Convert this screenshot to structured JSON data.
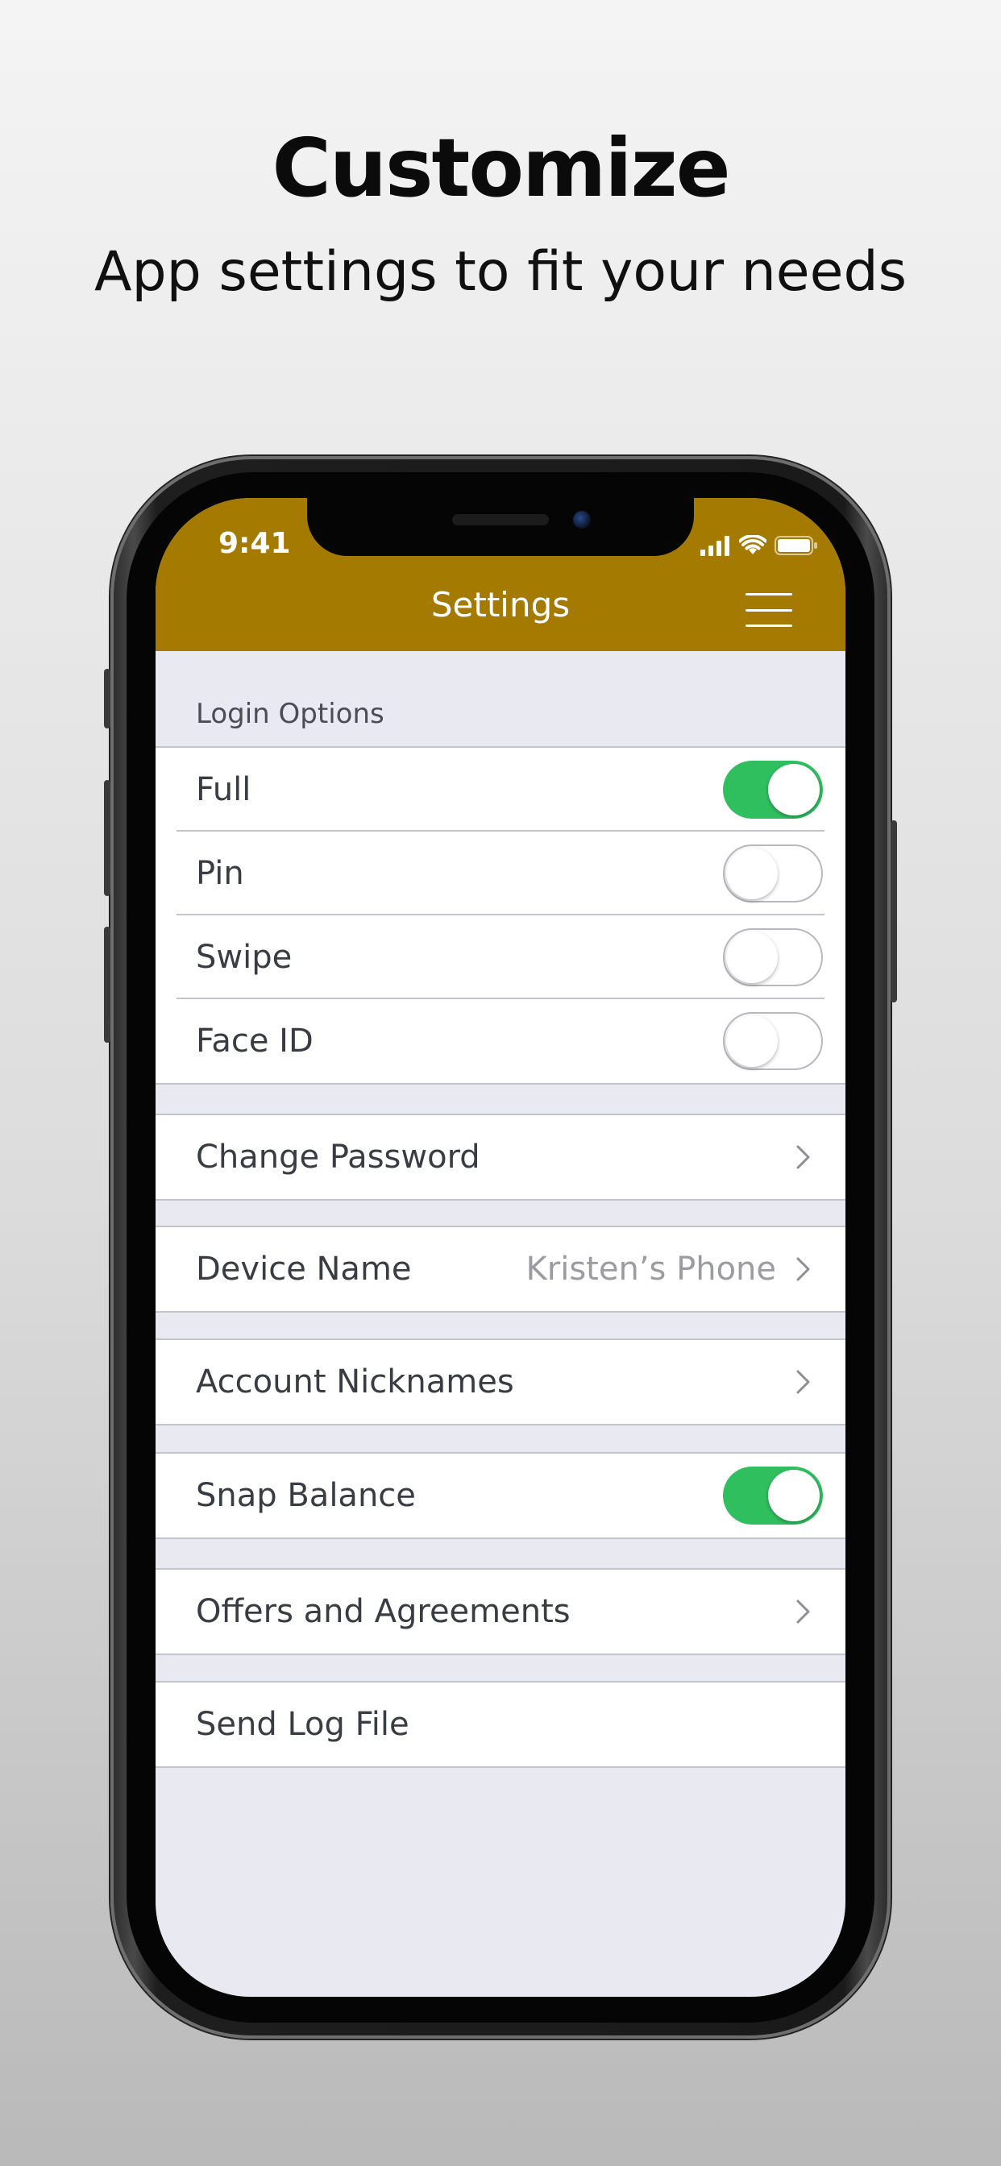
{
  "promo": {
    "title": "Customize",
    "subtitle": "App settings to fit your needs"
  },
  "colors": {
    "header_bg": "#a57a01",
    "toggle_on": "#2fbf5f",
    "list_bg": "#e9e9f2",
    "label_text": "#3a3c44",
    "detail_text": "#9b9ba2"
  },
  "status_bar": {
    "time": "9:41",
    "icons": [
      "signal-icon",
      "wifi-icon",
      "battery-icon"
    ]
  },
  "header": {
    "title": "Settings",
    "menu_icon": "hamburger-menu-icon"
  },
  "login_options": {
    "section_label": "Login Options",
    "items": [
      {
        "label": "Full",
        "enabled": true
      },
      {
        "label": "Pin",
        "enabled": false
      },
      {
        "label": "Swipe",
        "enabled": false
      },
      {
        "label": "Face ID",
        "enabled": false
      }
    ]
  },
  "settings": {
    "change_password": {
      "label": "Change Password",
      "icon": "chevron-right-icon"
    },
    "device_name": {
      "label": "Device Name",
      "value": "Kristen’s Phone",
      "icon": "chevron-right-icon"
    },
    "account_nicknames": {
      "label": "Account Nicknames",
      "icon": "chevron-right-icon"
    },
    "snap_balance": {
      "label": "Snap Balance",
      "enabled": true
    },
    "offers_agreements": {
      "label": "Offers and Agreements",
      "icon": "chevron-right-icon"
    },
    "send_log_file": {
      "label": "Send Log File"
    }
  }
}
